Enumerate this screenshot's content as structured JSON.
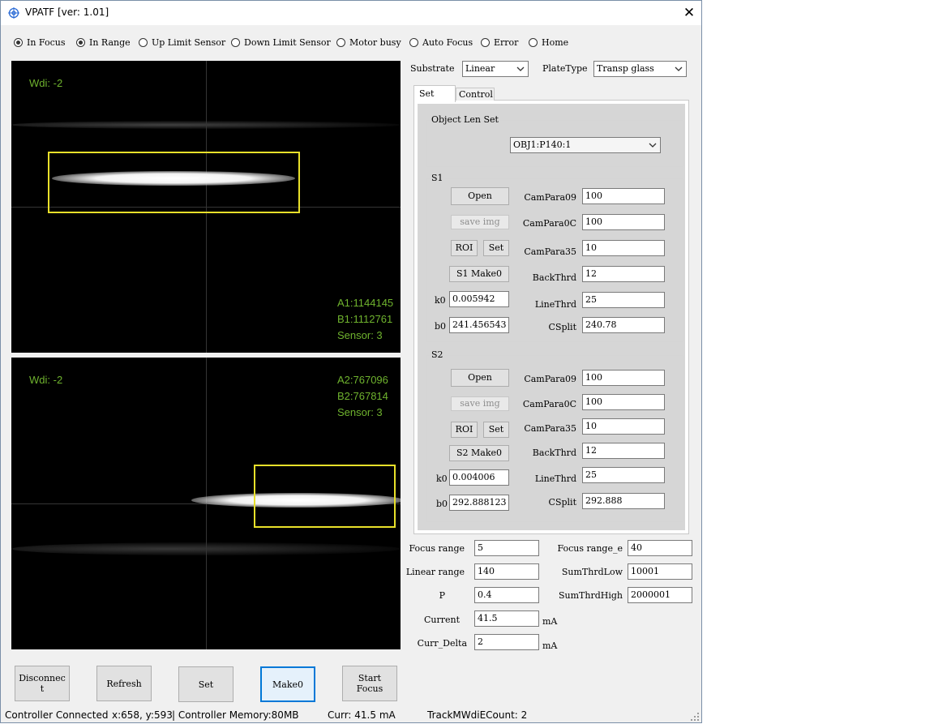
{
  "window": {
    "title": "VPATF [ver: 1.01]",
    "close": "✕"
  },
  "status_flags": [
    {
      "label": "In Focus",
      "checked": true
    },
    {
      "label": "In Range",
      "checked": true
    },
    {
      "label": "Up Limit Sensor",
      "checked": false
    },
    {
      "label": "Down Limit Sensor",
      "checked": false
    },
    {
      "label": "Motor busy",
      "checked": false
    },
    {
      "label": "Auto Focus",
      "checked": false
    },
    {
      "label": "Error",
      "checked": false
    },
    {
      "label": "Home",
      "checked": false
    }
  ],
  "camera1": {
    "wdi": "Wdi: -2",
    "a": "A1:1144145",
    "b": "B1:1112761",
    "sensor": "Sensor: 3"
  },
  "camera2": {
    "wdi": "Wdi: -2",
    "a": "A2:767096",
    "b": "B2:767814",
    "sensor": "Sensor: 3"
  },
  "overlay_colors": {
    "text": "#6fb32e",
    "roi": "#e8e02a"
  },
  "substrate": {
    "label": "Substrate",
    "value": "Linear"
  },
  "platetype": {
    "label": "PlateType",
    "value": "Transp glass"
  },
  "tabs": [
    "Set",
    "Control"
  ],
  "objlen": {
    "title": "Object Len Set",
    "value": "OBJ1:P140:1"
  },
  "s1": {
    "title": "S1",
    "open": "Open",
    "save_img": "save img",
    "roi": "ROI",
    "set": "Set",
    "make0": "S1 Make0",
    "k0_label": "k0",
    "k0": "0.005942",
    "b0_label": "b0",
    "b0": "241.456543",
    "params": [
      {
        "label": "CamPara09",
        "value": "100"
      },
      {
        "label": "CamPara0C",
        "value": "100"
      },
      {
        "label": "CamPara35",
        "value": "10"
      },
      {
        "label": "BackThrd",
        "value": "12"
      },
      {
        "label": "LineThrd",
        "value": "25"
      },
      {
        "label": "CSplit",
        "value": "240.78"
      }
    ]
  },
  "s2": {
    "title": "S2",
    "open": "Open",
    "save_img": "save img",
    "roi": "ROI",
    "set": "Set",
    "make0": "S2 Make0",
    "k0_label": "k0",
    "k0": "0.004006",
    "b0_label": "b0",
    "b0": "292.888123",
    "params": [
      {
        "label": "CamPara09",
        "value": "100"
      },
      {
        "label": "CamPara0C",
        "value": "100"
      },
      {
        "label": "CamPara35",
        "value": "10"
      },
      {
        "label": "BackThrd",
        "value": "12"
      },
      {
        "label": "LineThrd",
        "value": "25"
      },
      {
        "label": "CSplit",
        "value": "292.888"
      }
    ]
  },
  "focus": {
    "focus_range_label": "Focus range",
    "focus_range": "5",
    "focus_range_e_label": "Focus range_e",
    "focus_range_e": "40",
    "linear_range_label": "Linear range",
    "linear_range": "140",
    "sumthrdlow_label": "SumThrdLow",
    "sumthrdlow": "10001",
    "p_label": "P",
    "p": "0.4",
    "sumthrdhigh_label": "SumThrdHigh",
    "sumthrdhigh": "2000001",
    "current_label": "Current",
    "current": "41.5",
    "current_unit": "mA",
    "curr_delta_label": "Curr_Delta",
    "curr_delta": "2",
    "curr_delta_unit": "mA"
  },
  "buttons": {
    "disconnect": "Disconnect",
    "refresh": "Refresh",
    "set": "Set",
    "make0": "Make0",
    "start_focus": "Start Focus"
  },
  "statusbar": {
    "connection": "Controller Connected",
    "cursor": "x:658, y:593",
    "memory": "| Controller Memory:80MB",
    "curr": "Curr:  41.5  mA",
    "track": "TrackMWdiECount:  2"
  }
}
